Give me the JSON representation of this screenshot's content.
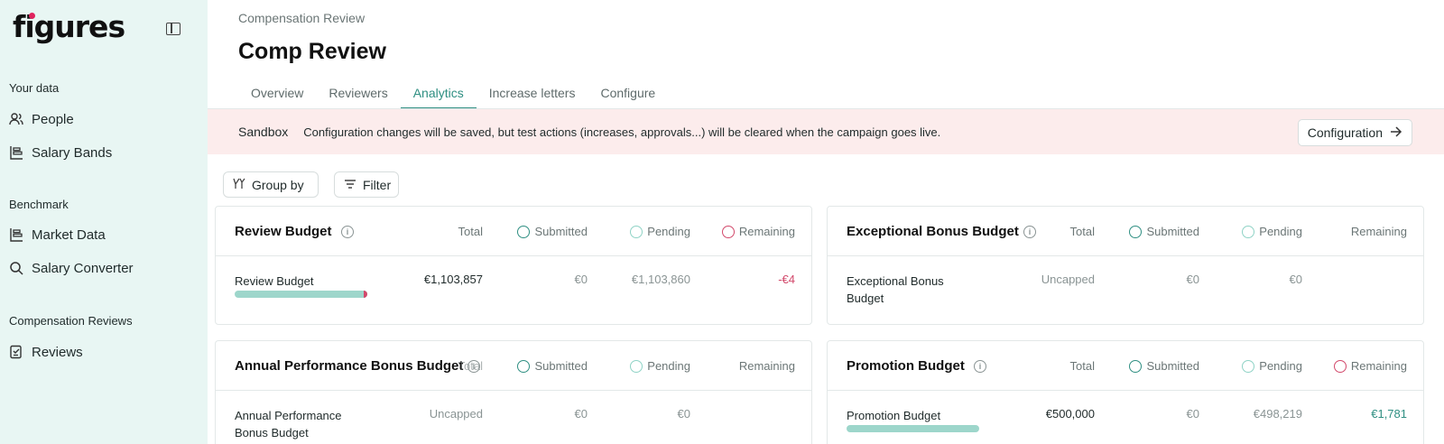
{
  "app": {
    "logo": "figures",
    "brand_color": "#2f8f82",
    "danger_color": "#d2496b"
  },
  "sidebar": {
    "sections": [
      {
        "label": "Your data",
        "items": [
          {
            "label": "People",
            "icon": "people-icon"
          },
          {
            "label": "Salary Bands",
            "icon": "salary-bands-icon"
          }
        ]
      },
      {
        "label": "Benchmark",
        "items": [
          {
            "label": "Market Data",
            "icon": "market-data-icon"
          },
          {
            "label": "Salary Converter",
            "icon": "search-icon"
          }
        ]
      },
      {
        "label": "Compensation Reviews",
        "items": [
          {
            "label": "Reviews",
            "icon": "reviews-icon"
          }
        ]
      }
    ]
  },
  "header": {
    "breadcrumb": "Compensation Review",
    "title": "Comp Review",
    "tabs": [
      "Overview",
      "Reviewers",
      "Analytics",
      "Increase letters",
      "Configure"
    ],
    "active_tab": "Analytics"
  },
  "banner": {
    "tag": "Sandbox",
    "message": "Configuration changes will be saved, but test actions (increases, approvals...) will be cleared when the campaign goes live.",
    "button_label": "Configuration"
  },
  "toolbar": {
    "group_by": "Group by",
    "filter": "Filter"
  },
  "columns": {
    "total": "Total",
    "submitted": "Submitted",
    "pending": "Pending",
    "remaining": "Remaining"
  },
  "cards": [
    {
      "title": "Review Budget",
      "row_name": "Review Budget",
      "total": "€1,103,857",
      "submitted": "€0",
      "pending": "€1,103,860",
      "remaining": "-€4",
      "bar_fill": 1.0,
      "over_budget": true
    },
    {
      "title": "Exceptional Bonus Budget",
      "row_name": "Exceptional Bonus Budget",
      "total": "Uncapped",
      "submitted": "€0",
      "pending": "€0",
      "remaining": ""
    },
    {
      "title": "Annual Performance Bonus Budget",
      "row_name": "Annual Performance Bonus Budget",
      "total": "Uncapped",
      "submitted": "€0",
      "pending": "€0",
      "remaining": ""
    },
    {
      "title": "Promotion Budget",
      "row_name": "Promotion Budget",
      "total": "€500,000",
      "submitted": "€0",
      "pending": "€498,219",
      "remaining": "€1,781",
      "bar_fill": 0.996
    }
  ]
}
